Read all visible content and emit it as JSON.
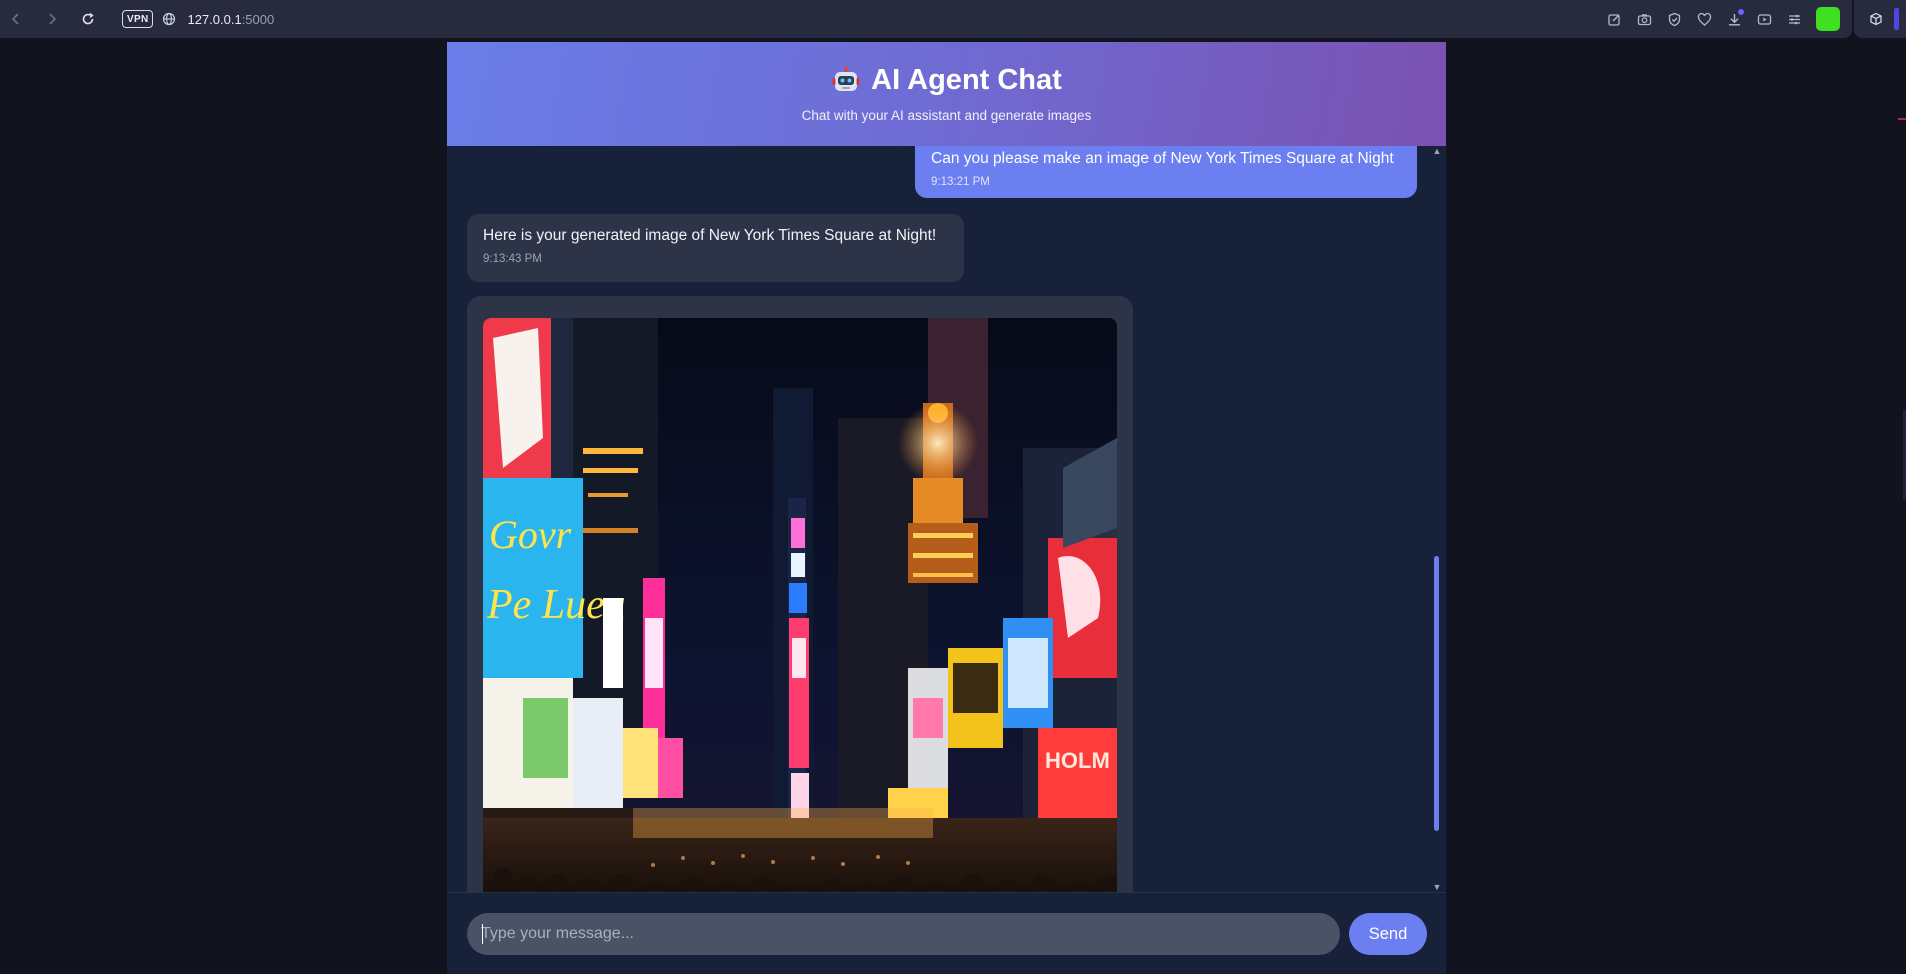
{
  "browser": {
    "vpn_label": "VPN",
    "url_host": "127.0.0.1",
    "url_port": ":5000",
    "icons": [
      "back-icon",
      "forward-icon",
      "reload-icon",
      "globe-icon",
      "edit-icon",
      "camera-icon",
      "shield-icon",
      "heart-icon",
      "download-icon",
      "media-icon",
      "menu-icon",
      "extension-icon",
      "cube-icon"
    ],
    "extension_color": "#3fe01f",
    "sidebar_accent": "#4f46e5"
  },
  "header": {
    "icon": "robot-icon",
    "title": "AI Agent Chat",
    "subtitle": "Chat with your AI assistant and generate images"
  },
  "messages": [
    {
      "role": "user",
      "text": "Can you please make an image of New York Times Square at Night",
      "time": "9:13:21 PM"
    },
    {
      "role": "assistant",
      "text": "Here is your generated image of New York Times Square at Night!",
      "time": "9:13:43 PM"
    },
    {
      "role": "assistant",
      "type": "image",
      "image": "generated-times-square-night-image"
    }
  ],
  "input": {
    "placeholder": "Type your message...",
    "value": "",
    "send_label": "Send"
  },
  "colors": {
    "accent": "#6b7ff0",
    "header_gradient_start": "#6a7de8",
    "header_gradient_end": "#7a52b1",
    "app_background": "#18213a",
    "page_background": "#11131f",
    "bubble_bot": "#2d3447"
  }
}
